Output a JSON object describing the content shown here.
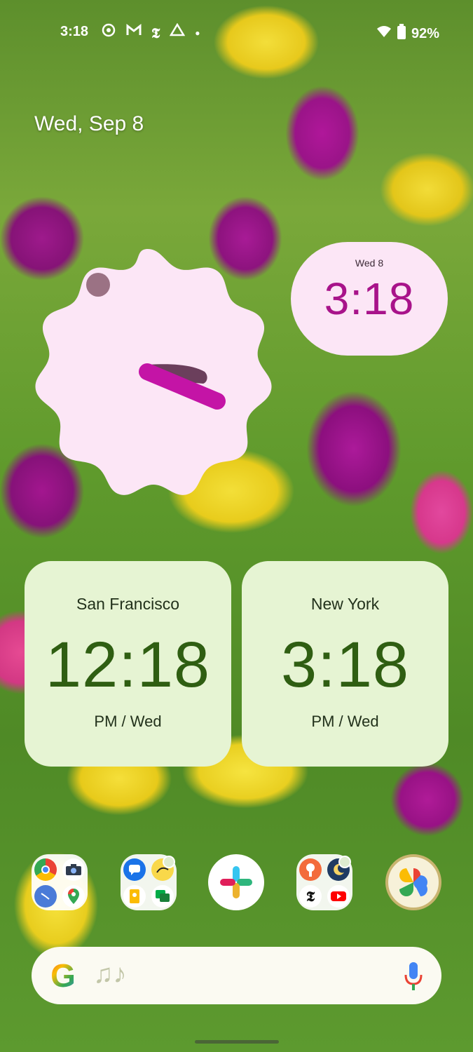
{
  "status_bar": {
    "time": "3:18",
    "notification_icons": [
      "screen-record-icon",
      "gmail-icon",
      "nyt-icon",
      "drive-icon",
      "dot-icon"
    ],
    "battery": "92%",
    "icons": [
      "wifi-icon",
      "battery-icon"
    ]
  },
  "home": {
    "date": "Wed, Sep 8"
  },
  "digital_clock": {
    "date": "Wed 8",
    "time": "3:18"
  },
  "world_clocks": [
    {
      "city": "San Francisco",
      "time": "12:18",
      "ampm_day": "PM / Wed"
    },
    {
      "city": "New York",
      "time": "3:18",
      "ampm_day": "PM / Wed"
    }
  ],
  "dock": [
    {
      "type": "folder",
      "apps": [
        "chrome-icon",
        "camera-icon",
        "clock-icon",
        "maps-icon"
      ]
    },
    {
      "type": "folder",
      "apps": [
        "messages-icon",
        "fit-icon",
        "keep-icon",
        "chat-icon"
      ]
    },
    {
      "type": "app",
      "name": "slack-icon"
    },
    {
      "type": "folder",
      "apps": [
        "podcast-icon",
        "moon-icon",
        "nyt-icon",
        "youtube-icon"
      ]
    },
    {
      "type": "app",
      "name": "photos-icon"
    }
  ],
  "search": {
    "google_logo": "G",
    "music_icon": "♫♪",
    "mic_icon": "mic-icon"
  },
  "colors": {
    "accent_pink": "#a8138a",
    "pill_bg": "#fce6f6",
    "card_bg": "#e6f4d3",
    "card_time": "#2f5e12"
  }
}
